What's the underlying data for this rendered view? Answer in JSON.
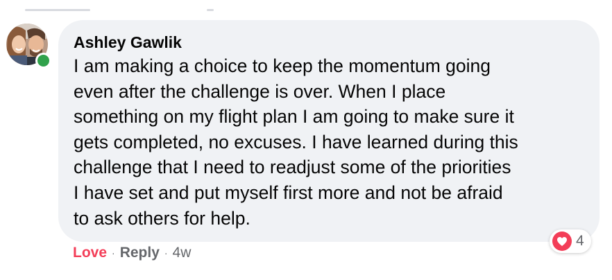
{
  "comment": {
    "author": "Ashley Gawlik",
    "text": "I am making a choice to keep the momentum going\neven after the challenge is over. When I place\nsomething on my flight plan I am going to make sure it\ngets completed, no excuses. I have learned during this\nchallenge that I need to readjust some of the priorities\nI have set and put myself first more and not be afraid\nto ask others for help.",
    "online_status_color": "#31a24c"
  },
  "reactions": {
    "icon": "heart-icon",
    "color": "#f33e58",
    "count": "4"
  },
  "actions": {
    "love_label": "Love",
    "separator": "·",
    "reply_label": "Reply",
    "timestamp": "4w"
  }
}
